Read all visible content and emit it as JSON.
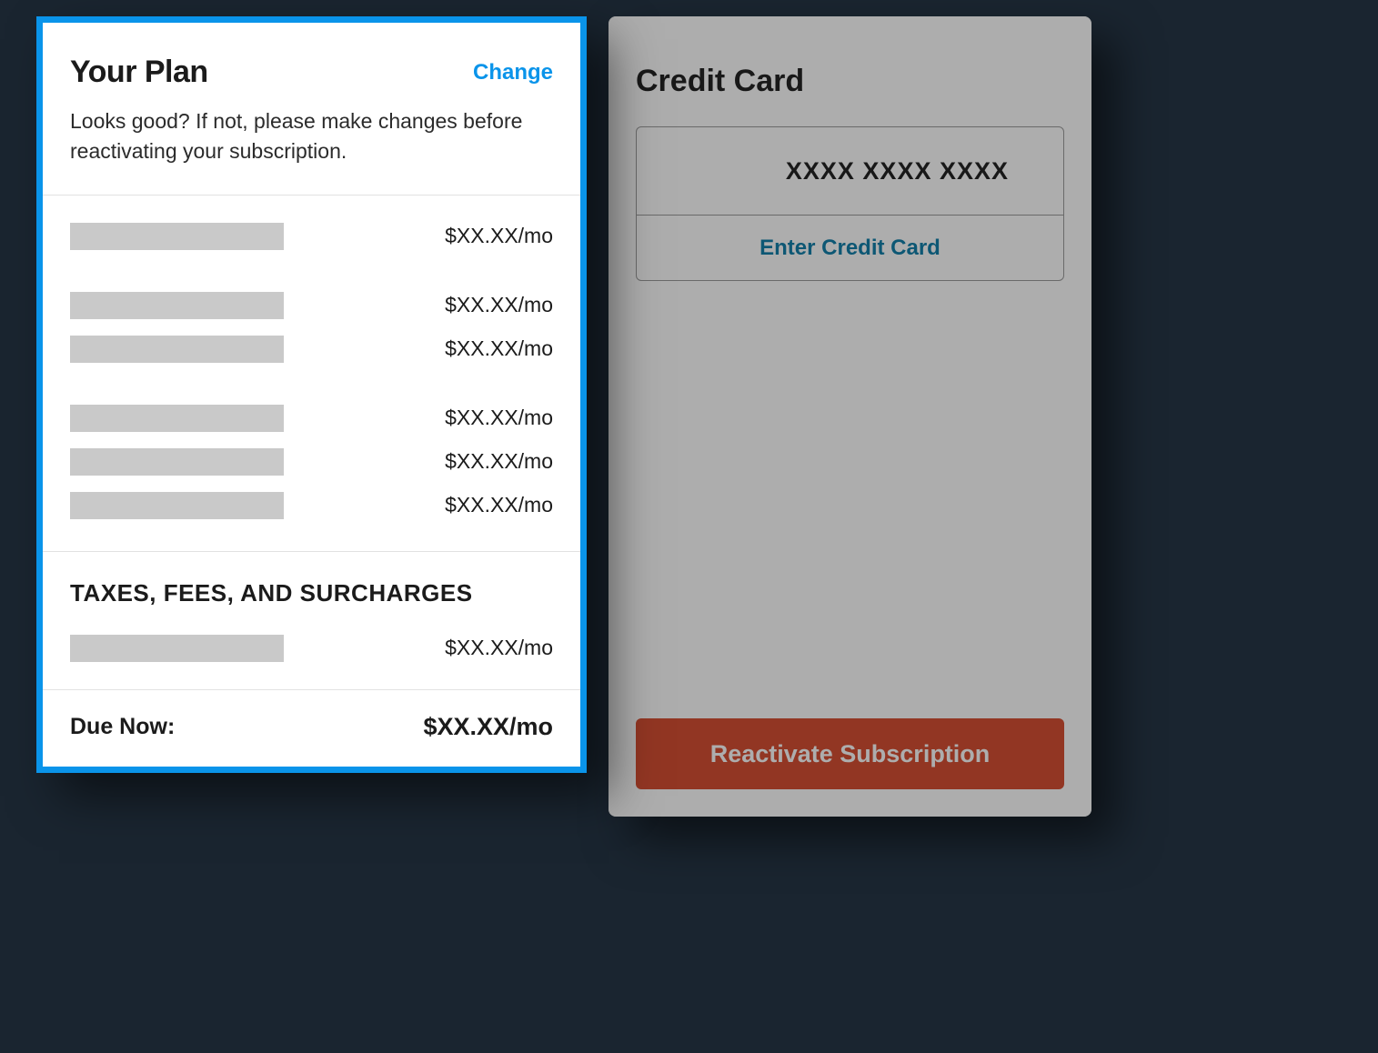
{
  "plan": {
    "title": "Your Plan",
    "change_label": "Change",
    "subtitle": "Looks good? If not, please make changes before reactivating your subscription.",
    "line_items": [
      {
        "price": "$XX.XX/mo"
      },
      {
        "price": "$XX.XX/mo"
      },
      {
        "price": "$XX.XX/mo"
      },
      {
        "price": "$XX.XX/mo"
      },
      {
        "price": "$XX.XX/mo"
      },
      {
        "price": "$XX.XX/mo"
      }
    ],
    "taxes_heading": "TAXES, FEES, AND SURCHARGES",
    "tax_items": [
      {
        "price": "$XX.XX/mo"
      }
    ],
    "due_label": "Due Now:",
    "due_value": "$XX.XX/mo"
  },
  "credit_card": {
    "heading": "Credit Card",
    "masked_number": "XXXX XXXX XXXX",
    "enter_label": "Enter Credit Card"
  },
  "actions": {
    "reactivate_label": "Reactivate Subscription"
  },
  "colors": {
    "accent": "#0a94ea",
    "cta": "#d6492b"
  }
}
